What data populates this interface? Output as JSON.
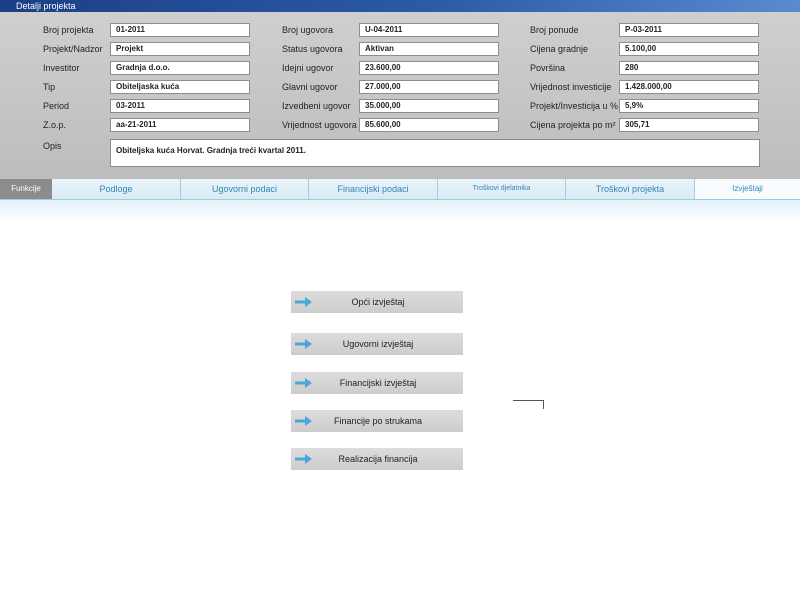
{
  "window": {
    "title": "Detalji projekta"
  },
  "details": {
    "col1": [
      {
        "label": "Broj projekta",
        "value": "01-2011"
      },
      {
        "label": "Projekt/Nadzor",
        "value": "Projekt"
      },
      {
        "label": "Investitor",
        "value": "Gradnja d.o.o."
      },
      {
        "label": "Tip",
        "value": "Obiteljaska kuća"
      },
      {
        "label": "Period",
        "value": "03-2011"
      },
      {
        "label": "Z.o.p.",
        "value": "aa-21-2011"
      }
    ],
    "col2": [
      {
        "label": "Broj ugovora",
        "value": "U-04-2011"
      },
      {
        "label": "Status ugovora",
        "value": "Aktivan"
      },
      {
        "label": "Idejni ugovor",
        "value": "23.600,00"
      },
      {
        "label": "Glavni ugovor",
        "value": "27.000,00"
      },
      {
        "label": "Izvedbeni ugovor",
        "value": "35.000,00"
      },
      {
        "label": "Vrijednost ugovora",
        "value": "85.600,00"
      }
    ],
    "col3": [
      {
        "label": "Broj ponude",
        "value": "P-03-2011"
      },
      {
        "label": "Cijena gradnje",
        "value": "5.100,00"
      },
      {
        "label": "Površina",
        "value": "280"
      },
      {
        "label": "Vrijednost investicije",
        "value": "1.428.000,00"
      },
      {
        "label": "Projekt/Investicija u %",
        "value": "5,9%"
      },
      {
        "label": "Cijena projekta po m²",
        "value": "305,71"
      }
    ],
    "opis": {
      "label": "Opis",
      "value": "Obiteljska kuća Horvat. Gradnja treći kvartal 2011."
    }
  },
  "tabs": {
    "funkcije": "Funkcije",
    "items": [
      {
        "label": "Podloge"
      },
      {
        "label": "Ugovorni podaci"
      },
      {
        "label": "Financijski podaci"
      },
      {
        "label": "Troškovi djelatnika"
      },
      {
        "label": "Troškovi projekta"
      },
      {
        "label": "Izvještaji"
      }
    ]
  },
  "reports": {
    "buttons": [
      {
        "label": "Opći izvještaj"
      },
      {
        "label": "Ugovorni izvještaj"
      },
      {
        "label": "Financijski izvještaj"
      },
      {
        "label": "Financije po strukama"
      },
      {
        "label": "Realizacija financija"
      }
    ]
  },
  "colors": {
    "accent": "#2f86b6",
    "arrow": "#4aa8d8",
    "titlebar": "#1c3f86"
  },
  "icons": {
    "report_button": "arrow-right-icon"
  }
}
